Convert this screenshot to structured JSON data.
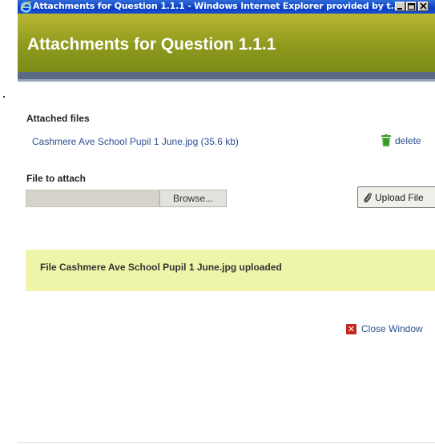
{
  "window": {
    "title": "Attachments for Question 1.1.1 - Windows Internet Explorer provided by t...",
    "icon": "ie-icon",
    "controls": [
      "minimize",
      "maximize",
      "close"
    ]
  },
  "header": {
    "title": "Attachments for Question 1.1.1",
    "color": "#8e9a1d"
  },
  "attached_files": {
    "label": "Attached files",
    "items": [
      {
        "name": "Cashmere Ave School Pupil 1 June.jpg (35.6 kb)",
        "action": "delete",
        "action_icon": "trash-icon"
      }
    ]
  },
  "file_to_attach": {
    "label": "File to attach",
    "value": "",
    "browse_label": "Browse...",
    "upload_label": "Upload File",
    "upload_icon": "paperclip-icon"
  },
  "message": {
    "text": "File Cashmere Ave School Pupil 1 June.jpg uploaded",
    "color": "#eef4a8"
  },
  "footer": {
    "close_label": "Close Window",
    "close_icon": "close-x-icon"
  }
}
